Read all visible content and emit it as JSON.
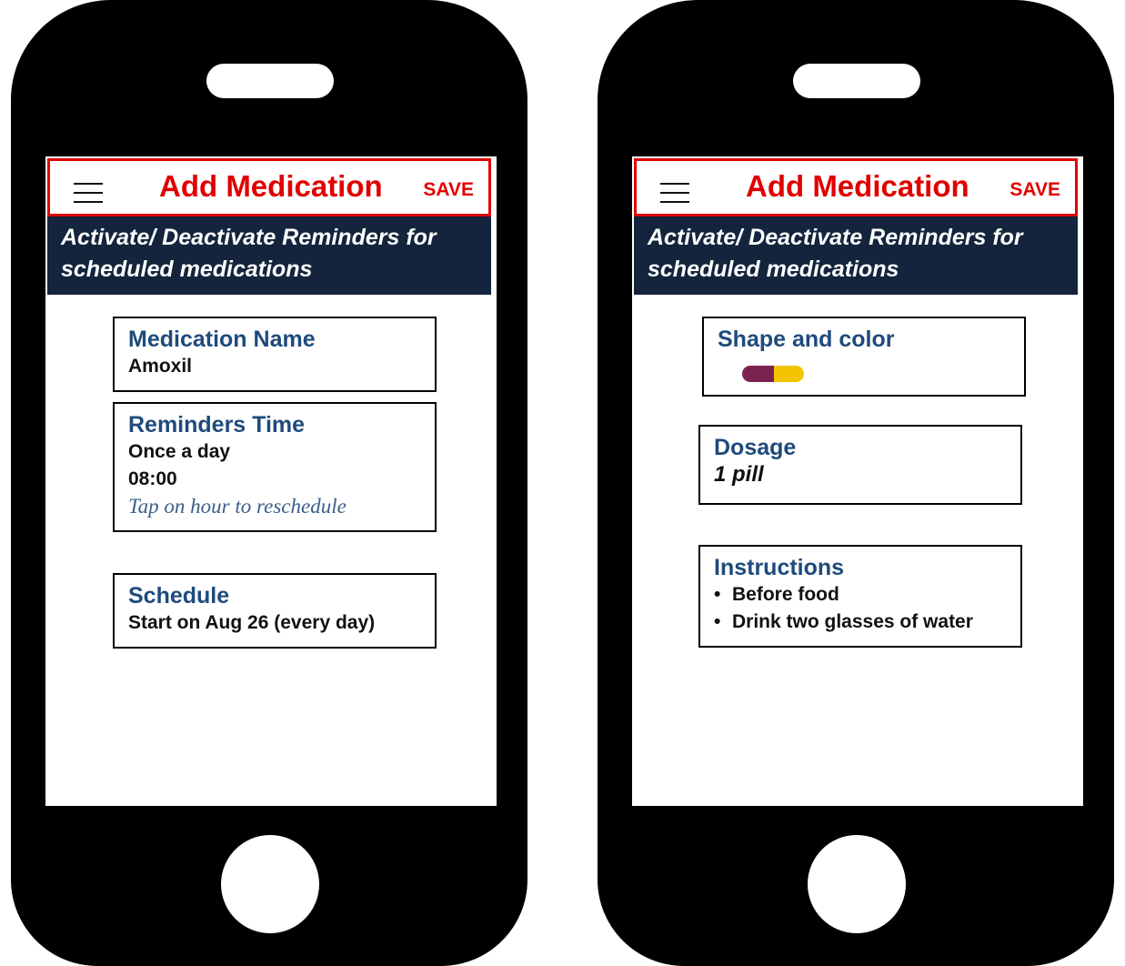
{
  "left_screen": {
    "header": {
      "title": "Add Medication",
      "save_label": "SAVE"
    },
    "banner": {
      "line1": "Activate/ Deactivate Reminders for",
      "line2": "scheduled medications"
    },
    "medication_name": {
      "title": "Medication Name",
      "value": "Amoxil"
    },
    "reminders_time": {
      "title": "Reminders Time",
      "frequency": "Once a day",
      "time": "08:00",
      "hint": "Tap on hour to reschedule"
    },
    "schedule": {
      "title": "Schedule",
      "value": "Start on Aug 26 (every day)"
    }
  },
  "right_screen": {
    "header": {
      "title": "Add Medication",
      "save_label": "SAVE"
    },
    "banner": {
      "line1": "Activate/ Deactivate Reminders for",
      "line2": "scheduled medications"
    },
    "shape_color": {
      "title": "Shape and color",
      "pill_icon": "capsule-icon",
      "pill_colors": [
        "#7b2350",
        "#f2c500"
      ]
    },
    "dosage": {
      "title": "Dosage",
      "value": "1 pill"
    },
    "instructions": {
      "title": "Instructions",
      "items": [
        "Before food",
        "Drink two glasses of water"
      ]
    }
  },
  "colors": {
    "accent": "#e00000",
    "banner_bg": "#13243c",
    "field_title": "#1f4a7c"
  },
  "icons": {
    "menu": "hamburger-menu-icon",
    "bullet": "•"
  }
}
